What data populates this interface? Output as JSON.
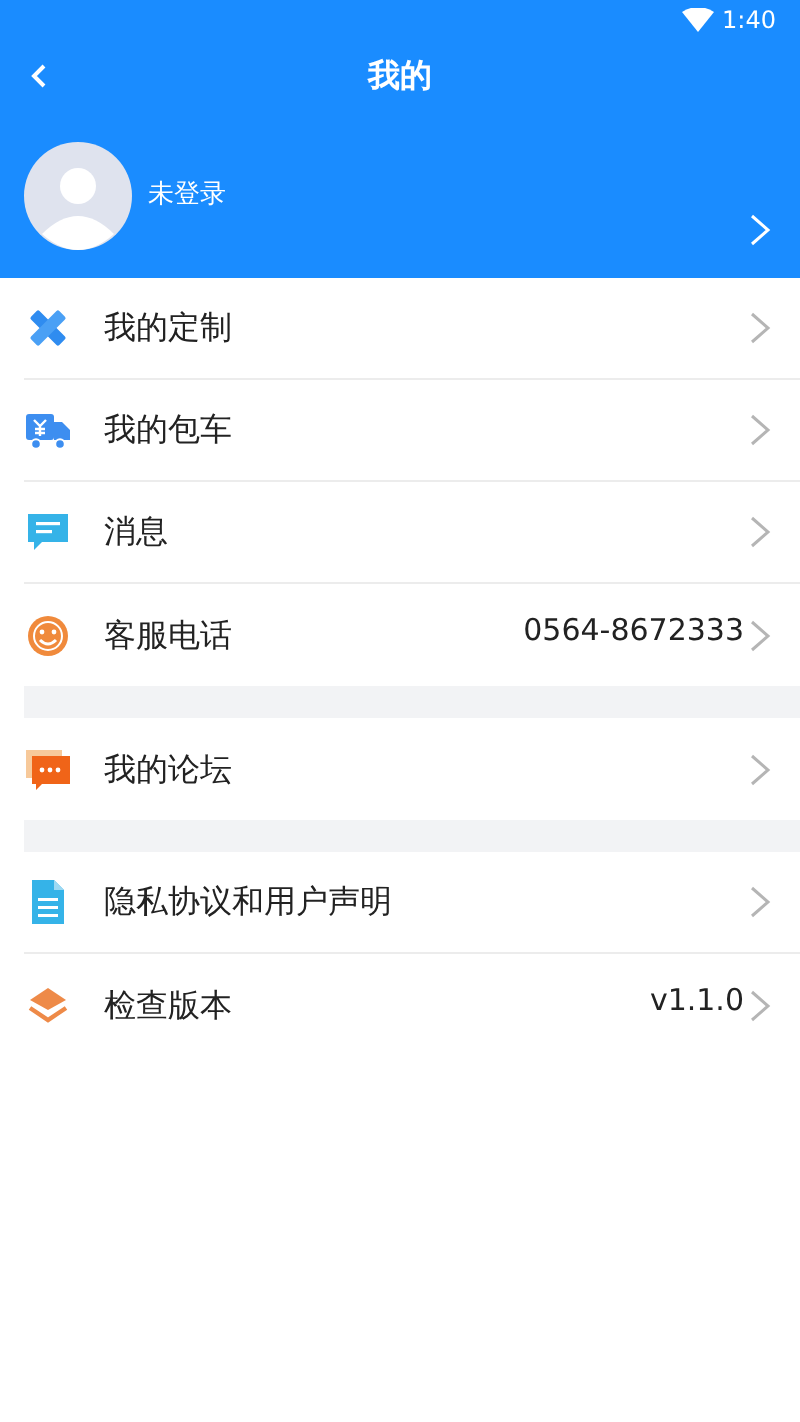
{
  "status_bar": {
    "time": "1:40"
  },
  "header": {
    "title": "我的"
  },
  "profile": {
    "name": "未登录"
  },
  "groups": [
    {
      "items": [
        {
          "kind": "pencil",
          "label": "我的定制"
        },
        {
          "kind": "truck",
          "label": "我的包车"
        },
        {
          "kind": "message",
          "label": "消息"
        },
        {
          "kind": "support",
          "label": "客服电话",
          "value": "0564-8672333"
        }
      ]
    },
    {
      "items": [
        {
          "kind": "forum",
          "label": "我的论坛"
        }
      ]
    },
    {
      "items": [
        {
          "kind": "document",
          "label": "隐私协议和用户声明"
        },
        {
          "kind": "layers",
          "label": "检查版本",
          "value": "v1.1.0"
        }
      ]
    }
  ]
}
